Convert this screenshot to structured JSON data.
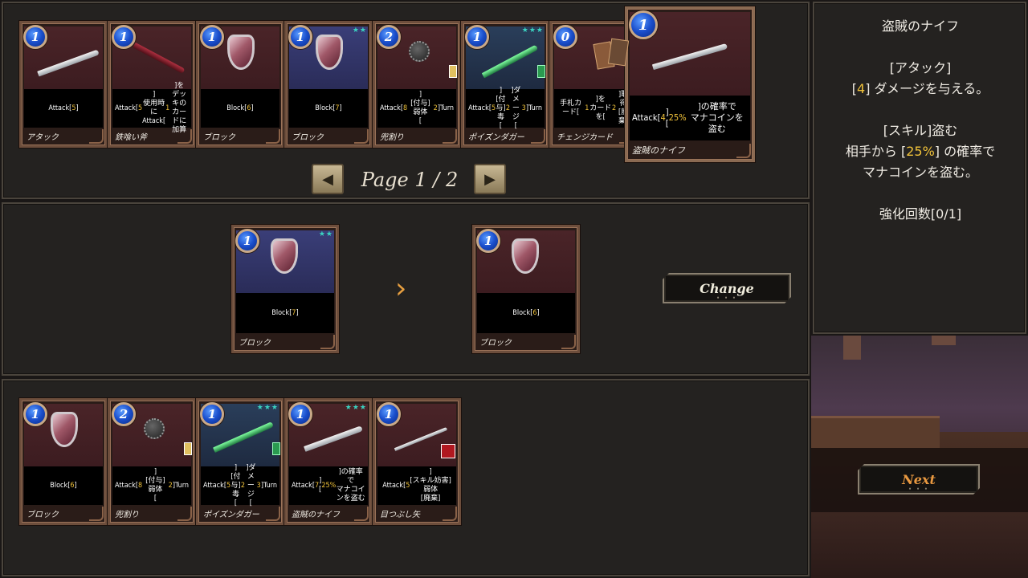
{
  "colors": {
    "accent_yellow": "#f0c23a",
    "star_teal": "#3ad2c0",
    "next_orange": "#e89840",
    "cost_blue": "#1a4ecc"
  },
  "top_cards": [
    {
      "cost": "1",
      "stars": "",
      "text": "Attack[5]",
      "name": "アタック"
    },
    {
      "cost": "1",
      "stars": "",
      "text": "Attack[5]\n使用時にAttack[1]を\nデッキのカードに加算",
      "name": "鉄喰い斧"
    },
    {
      "cost": "1",
      "stars": "",
      "text": "Block[6]",
      "name": "ブロック"
    },
    {
      "cost": "1",
      "stars": "★★",
      "text": "Block[7]",
      "name": "ブロック"
    },
    {
      "cost": "2",
      "stars": "",
      "text": "Attack[8]\n[付与]弱体\n[2]Turn",
      "name": "兜割り"
    },
    {
      "cost": "1",
      "stars": "★★★",
      "text": "Attack[5]\n[付与]毒\n[2]ダメージ\n[3]Turn",
      "name": "ポイズンダガー"
    },
    {
      "cost": "0",
      "stars": "",
      "text": "手札カード[1]を\nカードを[2]取得\n[廃棄]",
      "name": "チェンジカード"
    },
    {
      "cost": "1",
      "stars": "",
      "text": "Attack[4]\n[25%]の確率で\nマナコインを盗む",
      "name": "盗賊のナイフ"
    }
  ],
  "pager": {
    "label": "Page 1 / 2",
    "prev_icon": "◀",
    "next_icon": "▶"
  },
  "change_from": {
    "cost": "1",
    "stars": "★★",
    "text": "Block[7]",
    "name": "ブロック"
  },
  "change_to": {
    "cost": "1",
    "text": "Block[6]",
    "name": "ブロック"
  },
  "transform_arrow": "›",
  "change_button": "Change",
  "bottom_cards": [
    {
      "cost": "1",
      "stars": "",
      "text": "Block[6]",
      "name": "ブロック"
    },
    {
      "cost": "2",
      "stars": "",
      "text": "Attack[8]\n[付与]弱体\n[2]Turn",
      "name": "兜割り"
    },
    {
      "cost": "1",
      "stars": "★★★",
      "text": "Attack[5]\n[付与]毒\n[2]ダメージ\n[3]Turn",
      "name": "ポイズンダガー"
    },
    {
      "cost": "1",
      "stars": "★★★",
      "text": "Attack[7]\n[25%]の確率で\nマナコインを盗む",
      "name": "盗賊のナイフ"
    },
    {
      "cost": "1",
      "stars": "",
      "text": "Attack[5]\n[スキル妨害]\n弱体\n[廃棄]",
      "name": "目つぶし矢"
    }
  ],
  "detail": {
    "title": "盗賊のナイフ",
    "attack_header": "[アタック]",
    "attack_line": "[4] ダメージを与える。",
    "skill_header": "[スキル]盗む",
    "skill_line1": "相手から [25%] の確率で",
    "skill_line2": "マナコインを盗む。",
    "upgrade": "強化回数[0/1]"
  },
  "next_button": "Next"
}
